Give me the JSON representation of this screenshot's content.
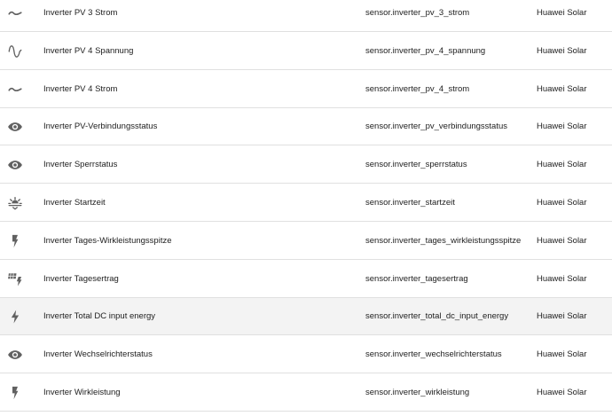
{
  "colors": {
    "icon": "#616161",
    "text": "#212121",
    "divider": "#e0e0e0",
    "row_highlight": "#f3f3f3",
    "background": "#ffffff"
  },
  "rows": [
    {
      "icon": "current-dc-icon",
      "name": "Inverter PV 3 Strom",
      "entity_id": "sensor.inverter_pv_3_strom",
      "integration": "Huawei Solar"
    },
    {
      "icon": "sine-wave-icon",
      "name": "Inverter PV 4 Spannung",
      "entity_id": "sensor.inverter_pv_4_spannung",
      "integration": "Huawei Solar"
    },
    {
      "icon": "current-dc-icon",
      "name": "Inverter PV 4 Strom",
      "entity_id": "sensor.inverter_pv_4_strom",
      "integration": "Huawei Solar"
    },
    {
      "icon": "eye-icon",
      "name": "Inverter PV-Verbindungsstatus",
      "entity_id": "sensor.inverter_pv_verbindungsstatus",
      "integration": "Huawei Solar"
    },
    {
      "icon": "eye-icon",
      "name": "Inverter Sperrstatus",
      "entity_id": "sensor.inverter_sperrstatus",
      "integration": "Huawei Solar"
    },
    {
      "icon": "sunrise-icon",
      "name": "Inverter Startzeit",
      "entity_id": "sensor.inverter_startzeit",
      "integration": "Huawei Solar"
    },
    {
      "icon": "lightning-icon",
      "name": "Inverter Tages-Wirkleistungsspitze",
      "entity_id": "sensor.inverter_tages_wirkleistungsspitze",
      "integration": "Huawei Solar"
    },
    {
      "icon": "solar-power-icon",
      "name": "Inverter Tagesertrag",
      "entity_id": "sensor.inverter_tagesertrag",
      "integration": "Huawei Solar"
    },
    {
      "icon": "lightning-bolt-icon",
      "name": "Inverter Total DC input energy",
      "entity_id": "sensor.inverter_total_dc_input_energy",
      "integration": "Huawei Solar",
      "highlighted": true
    },
    {
      "icon": "eye-icon",
      "name": "Inverter Wechselrichterstatus",
      "entity_id": "sensor.inverter_wechselrichterstatus",
      "integration": "Huawei Solar"
    },
    {
      "icon": "lightning-icon",
      "name": "Inverter Wirkleistung",
      "entity_id": "sensor.inverter_wirkleistung",
      "integration": "Huawei Solar"
    }
  ]
}
